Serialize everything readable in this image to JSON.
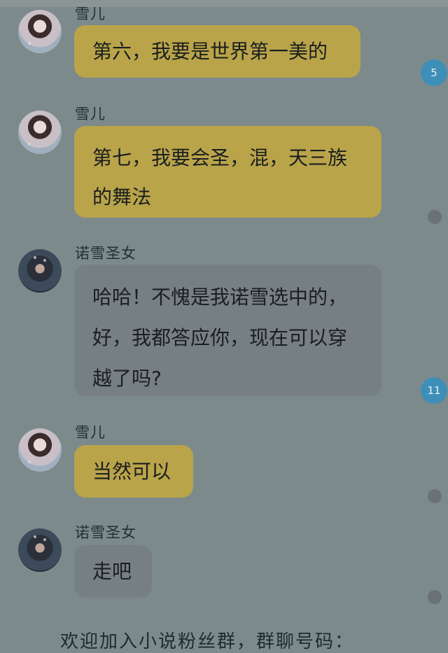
{
  "messages": [
    {
      "sender": "雪儿",
      "text": "第六，我要是世界第一美的"
    },
    {
      "sender": "雪儿",
      "lines": [
        "第七，我要会圣，混，天三族",
        "的舞法"
      ]
    },
    {
      "sender": "诺雪圣女",
      "lines": [
        "哈哈！不愧是我诺雪选中的，",
        "好，我都答应你，现在可以穿",
        "越了吗?"
      ]
    },
    {
      "sender": "雪儿",
      "text": "当然可以"
    },
    {
      "sender": "诺雪圣女",
      "text": "走吧"
    }
  ],
  "side_badges": [
    "5",
    "11"
  ],
  "footer": {
    "text": "欢迎加入小说粉丝群，群聊号码："
  },
  "colors": {
    "background": "#7d8a8c",
    "user_bubble": "#b9a44a",
    "other_bubble": "#767f84",
    "badge": "#3d8fb8"
  }
}
